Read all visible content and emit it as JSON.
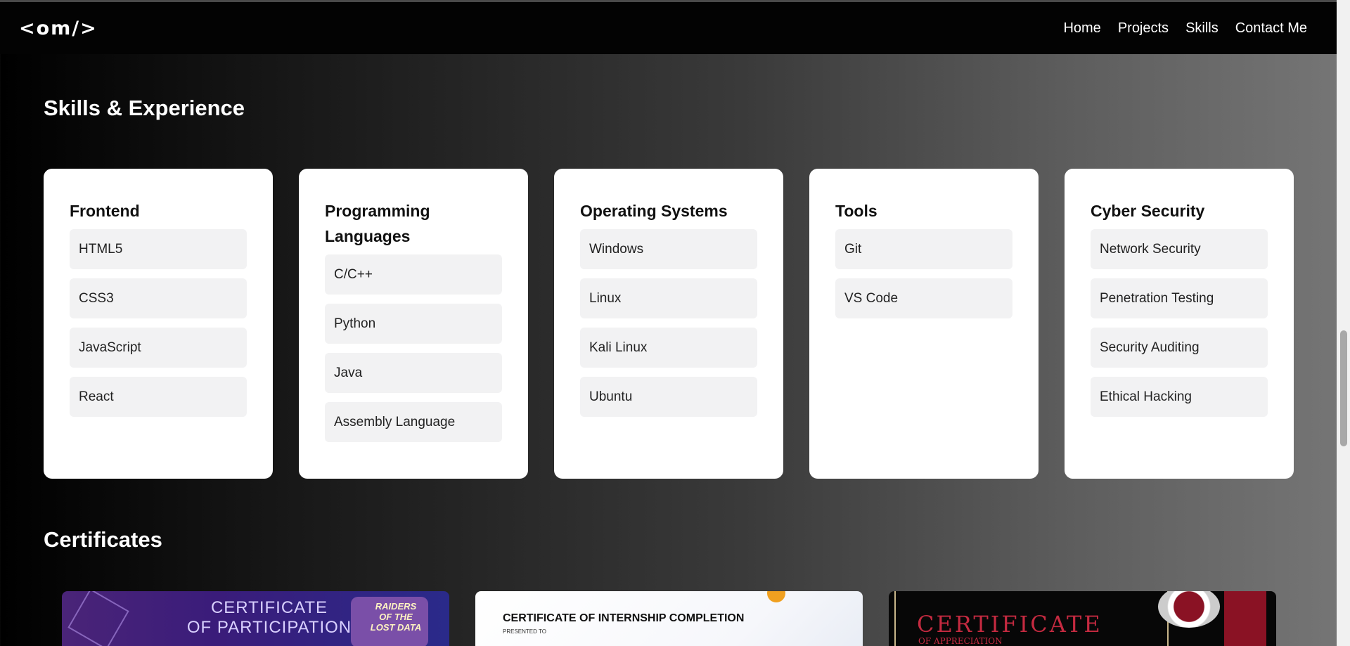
{
  "header": {
    "logo": "<om/>",
    "nav": [
      "Home",
      "Projects",
      "Skills",
      "Contact Me"
    ]
  },
  "skills_section": {
    "title": "Skills & Experience",
    "categories": [
      {
        "title": "Frontend",
        "items": [
          "HTML5",
          "CSS3",
          "JavaScript",
          "React"
        ]
      },
      {
        "title": "Programming Languages",
        "items": [
          "C/C++",
          "Python",
          "Java",
          "Assembly Language"
        ]
      },
      {
        "title": "Operating Systems",
        "items": [
          "Windows",
          "Linux",
          "Kali Linux",
          "Ubuntu"
        ]
      },
      {
        "title": "Tools",
        "items": [
          "Git",
          "VS Code"
        ]
      },
      {
        "title": "Cyber Security",
        "items": [
          "Network Security",
          "Penetration Testing",
          "Security Auditing",
          "Ethical Hacking"
        ]
      }
    ]
  },
  "certificates_section": {
    "title": "Certificates",
    "items": [
      {
        "line1": "CERTIFICATE",
        "line2": "OF PARTICIPATION",
        "badge": "RAIDERS OF THE LOST DATA"
      },
      {
        "title": "CERTIFICATE OF INTERNSHIP COMPLETION",
        "subtitle": "PRESENTED TO"
      },
      {
        "title": "CERTIFICATE",
        "subtitle": "OF APPRECIATION"
      }
    ]
  }
}
